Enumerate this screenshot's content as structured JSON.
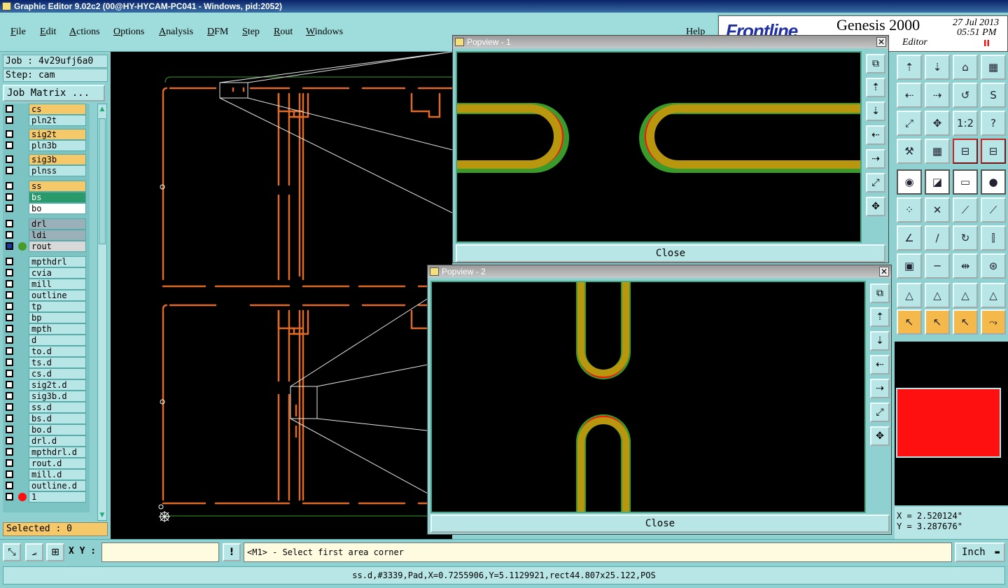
{
  "window": {
    "title": "Graphic Editor 9.02c2 (00@HY-HYCAM-PC041 - Windows, pid:2052)"
  },
  "menu": [
    "File",
    "Edit",
    "Actions",
    "Options",
    "Analysis",
    "DFM",
    "Step",
    "Rout",
    "Windows"
  ],
  "help_label": "Help",
  "brand": {
    "logo": "Frontline",
    "product": "Genesis 2000",
    "date": "27 Jul 2013",
    "time": "05:51 PM",
    "subtitle": "Editor",
    "pause": "II"
  },
  "job": {
    "job_label": "Job : 4v29ufj6a0",
    "step_label": "Step: cam",
    "matrix_button": "Job Matrix ..."
  },
  "layers": [
    {
      "name": "cs",
      "color": "#f5c86a"
    },
    {
      "name": "pln2t",
      "color": "#b8e6e6"
    },
    {
      "name": "sig2t",
      "color": "#f5c86a"
    },
    {
      "name": "pln3b",
      "color": "#b8e6e6"
    },
    {
      "name": "sig3b",
      "color": "#f5c86a"
    },
    {
      "name": "plnss",
      "color": "#b8e6e6"
    },
    {
      "name": "ss",
      "color": "#f5c86a"
    },
    {
      "name": "bs",
      "color": "#2a9a6a"
    },
    {
      "name": "bo",
      "color": "#ffffff"
    },
    {
      "name": "drl",
      "color": "#9ab0b8"
    },
    {
      "name": "ldi",
      "color": "#9ab0b8"
    },
    {
      "name": "rout",
      "color": "#d8d8d8",
      "dot": "#4a9a2a",
      "active": true
    },
    {
      "name": "mpthdrl",
      "color": "#b8e6e6"
    },
    {
      "name": "cvia",
      "color": "#b8e6e6"
    },
    {
      "name": "mill",
      "color": "#b8e6e6"
    },
    {
      "name": "outline",
      "color": "#b8e6e6"
    },
    {
      "name": "tp",
      "color": "#b8e6e6"
    },
    {
      "name": "bp",
      "color": "#b8e6e6"
    },
    {
      "name": "mpth",
      "color": "#b8e6e6"
    },
    {
      "name": "d",
      "color": "#b8e6e6"
    },
    {
      "name": "to.d",
      "color": "#b8e6e6"
    },
    {
      "name": "ts.d",
      "color": "#b8e6e6"
    },
    {
      "name": "cs.d",
      "color": "#b8e6e6"
    },
    {
      "name": "sig2t.d",
      "color": "#b8e6e6"
    },
    {
      "name": "sig3b.d",
      "color": "#b8e6e6"
    },
    {
      "name": "ss.d",
      "color": "#b8e6e6"
    },
    {
      "name": "bs.d",
      "color": "#b8e6e6"
    },
    {
      "name": "bo.d",
      "color": "#b8e6e6"
    },
    {
      "name": "drl.d",
      "color": "#b8e6e6"
    },
    {
      "name": "mpthdrl.d",
      "color": "#b8e6e6"
    },
    {
      "name": "rout.d",
      "color": "#b8e6e6"
    },
    {
      "name": "mill.d",
      "color": "#b8e6e6"
    },
    {
      "name": "outline.d",
      "color": "#b8e6e6"
    },
    {
      "name": "1",
      "color": "#b8e6e6",
      "dot": "#ff1010"
    }
  ],
  "selected_label": "Selected : 0",
  "popview1": {
    "title": "Popview - 1",
    "close_label": "Close"
  },
  "popview2": {
    "title": "Popview - 2",
    "close_label": "Close"
  },
  "close_x": "✕",
  "coords": {
    "x": "X = 2.520124\"",
    "y": "Y = 3.287676\""
  },
  "command": {
    "xy_label": "X Y :",
    "xy_value": "",
    "message": "<M1> - Select first area corner",
    "units": "Inch"
  },
  "status": "ss.d,#3339,Pad,X=0.7255906,Y=5.1129921,rect44.807x25.122,POS",
  "colors": {
    "route_orange": "#e06a28",
    "copper": "#b8960e",
    "green": "#3a9a2a",
    "red": "#ff1010"
  },
  "toolbox_icons": [
    "layer-up-icon",
    "layer-down-icon",
    "home-icon",
    "window-icon",
    "page-left-icon",
    "page-right-icon",
    "undo-view-icon",
    "s-curve-icon",
    "fit-icon",
    "center-icon",
    "scale-1-2-icon",
    "help-query-icon",
    "tools-icon",
    "grid-icon",
    "feature-select-icon",
    "feature-select-2-icon",
    "measure-pad-icon",
    "zoom-box-icon",
    "ruler-icon",
    "pad-icon",
    "connect-icon",
    "cross-icon",
    "line-dot-icon",
    "line-dot-2-icon",
    "angle-icon",
    "line-icon",
    "arc-icon",
    "align-icon",
    "point-icon",
    "minus-line-icon",
    "dim-icon",
    "snap-icon",
    "triangle-icon",
    "triangle-2-icon",
    "triangle-3-icon",
    "triangle-4-icon",
    "pointer-icon",
    "pointer-box-icon",
    "pointer-circle-icon",
    "pointer-path-icon"
  ]
}
